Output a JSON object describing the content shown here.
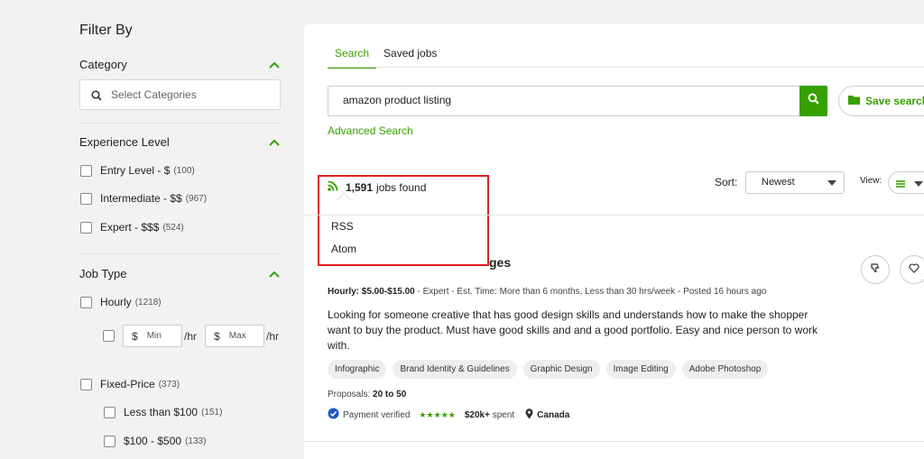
{
  "sidebar": {
    "title": "Filter By",
    "category": {
      "title": "Category",
      "search_placeholder": "Select Categories"
    },
    "experience": {
      "title": "Experience Level",
      "options": [
        {
          "label": "Entry Level - $",
          "count": "(100)"
        },
        {
          "label": "Intermediate - $$",
          "count": "(967)"
        },
        {
          "label": "Expert - $$$",
          "count": "(524)"
        }
      ]
    },
    "job_type": {
      "title": "Job Type",
      "hourly": {
        "label": "Hourly",
        "count": "(1218)"
      },
      "rate": {
        "currency": "$",
        "min_placeholder": "Min",
        "max_placeholder": "Max",
        "unit": "/hr"
      },
      "fixed": {
        "label": "Fixed-Price",
        "count": "(373)"
      },
      "fixed_options": [
        {
          "label": "Less than $100",
          "count": "(151)"
        },
        {
          "label": "$100 - $500",
          "count": "(133)"
        }
      ]
    }
  },
  "main": {
    "tabs": [
      {
        "label": "Search",
        "active": true
      },
      {
        "label": "Saved jobs",
        "active": false
      }
    ],
    "search": {
      "value": "amazon product listing"
    },
    "save_search_label": "Save search",
    "advanced_search_label": "Advanced Search",
    "results": {
      "count": "1,591",
      "suffix": "jobs found"
    },
    "feed_menu": [
      "RSS",
      "Atom"
    ],
    "sort": {
      "label": "Sort:",
      "value": "Newest"
    },
    "view": {
      "label": "View:"
    },
    "job": {
      "title_fragment": "ges",
      "meta": {
        "rate": "Hourly: $5.00-$15.00",
        "rest": " - Expert - Est. Time: More than 6 months, Less than 30 hrs/week - Posted 16 hours ago"
      },
      "description": "Looking for someone creative that has good design skills and understands how to make the shopper want to buy the product. Must have good skills and and a good portfolio. Easy and nice person to work with.",
      "skills": [
        "Infographic",
        "Brand Identity & Guidelines",
        "Graphic Design",
        "Image Editing",
        "Adobe Photoshop"
      ],
      "proposals_label": "Proposals:",
      "proposals_value": "20 to 50",
      "payment": "Payment verified",
      "stars": "★★★★★",
      "spent_value": "$20k+",
      "spent_label": "spent",
      "location": "Canada"
    }
  },
  "colors": {
    "accent": "#37a000",
    "highlight": "#e02020"
  }
}
